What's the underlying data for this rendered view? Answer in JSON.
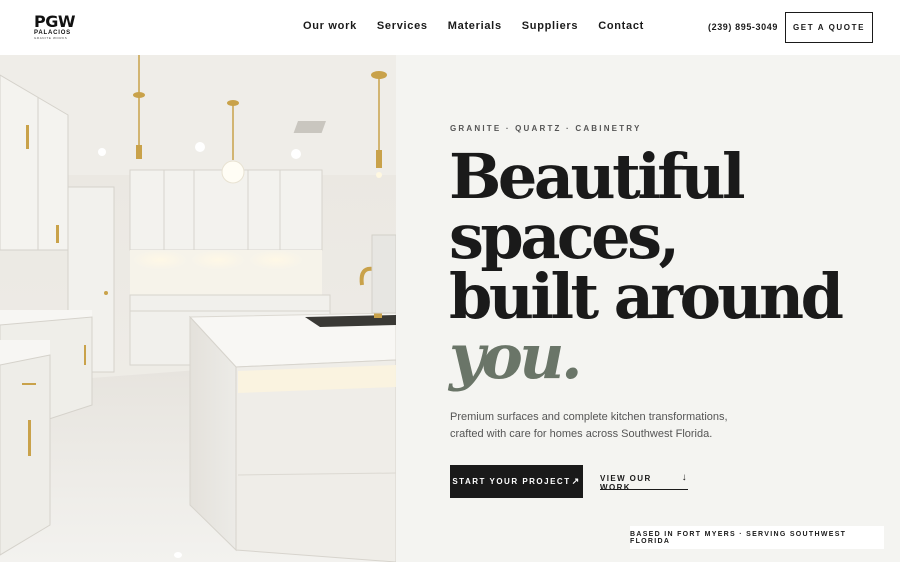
{
  "brand": {
    "logo_mark": "PGW",
    "logo_name": "PALACIOS",
    "logo_sub": "GRANITE WORKS"
  },
  "nav": {
    "items": [
      {
        "label": "Our work"
      },
      {
        "label": "Services"
      },
      {
        "label": "Materials"
      },
      {
        "label": "Suppliers"
      },
      {
        "label": "Contact"
      }
    ]
  },
  "header": {
    "phone": "(239) 895-3049",
    "quote_label": "GET A QUOTE"
  },
  "hero": {
    "eyebrow": "GRANITE · QUARTZ · CABINETRY",
    "headline_line1": "Beautiful",
    "headline_line2": "spaces,",
    "headline_line3": "built around",
    "headline_accent": "you.",
    "subcopy": "Premium surfaces and complete kitchen transformations, crafted with care for homes across Southwest Florida.",
    "primary_cta": "START YOUR PROJECT",
    "primary_cta_icon": "↗",
    "secondary_cta": "VIEW OUR WORK",
    "secondary_cta_icon": "↓",
    "location_badge": "BASED IN FORT MYERS · SERVING SOUTHWEST FLORIDA"
  },
  "colors": {
    "panel_bg": "#f4f4f1",
    "accent_green": "#6a7568",
    "ink": "#1a1a1a",
    "brass": "#c9a24a"
  }
}
